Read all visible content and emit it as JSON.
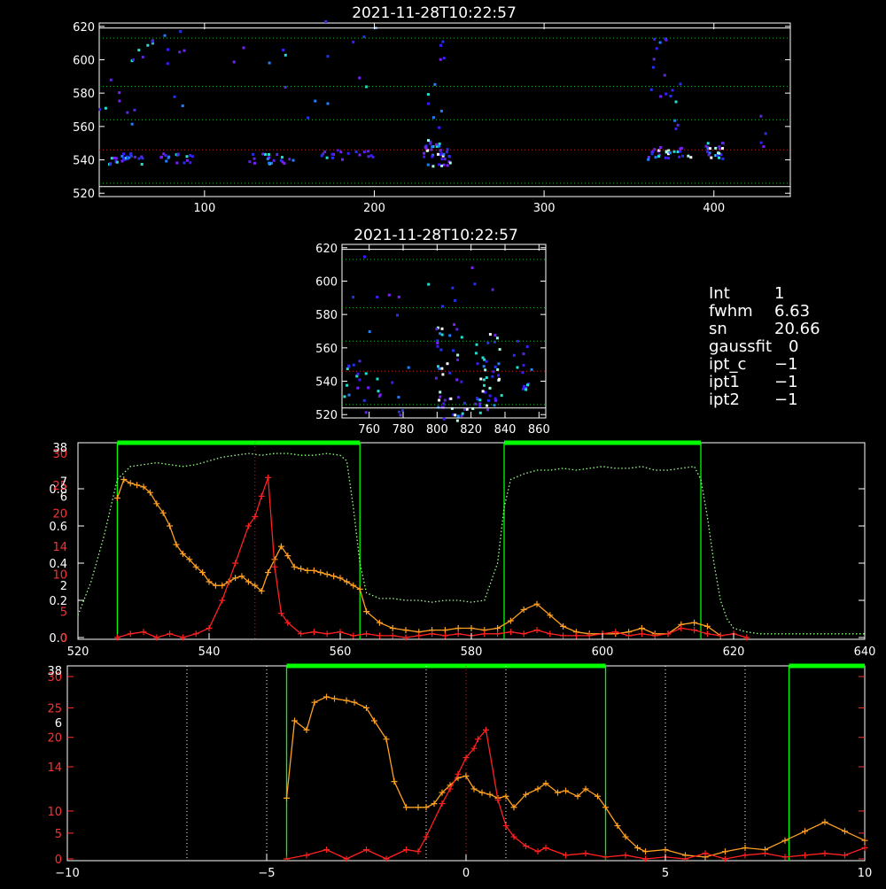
{
  "top_image": {
    "title": "2021-11-28T10:22:57",
    "y_ticks": [
      "520",
      "540",
      "560",
      "580",
      "600",
      "620"
    ],
    "x_ticks": [
      "100",
      "200",
      "300",
      "400"
    ]
  },
  "mid_image": {
    "title": "2021-11-28T10:22:57",
    "y_ticks": [
      "520",
      "540",
      "560",
      "580",
      "600",
      "620"
    ],
    "x_ticks": [
      "760",
      "780",
      "800",
      "820",
      "840",
      "860"
    ]
  },
  "info": {
    "rows": [
      {
        "label": "Int",
        "value": "1"
      },
      {
        "label": "fwhm",
        "value": "6.63"
      },
      {
        "label": "sn",
        "value": "20.66"
      },
      {
        "label": "gaussfit",
        "value": "0"
      },
      {
        "label": "ipt_c",
        "value": "−1"
      },
      {
        "label": "ipt1",
        "value": "−1"
      },
      {
        "label": "ipt2",
        "value": "−1"
      }
    ]
  },
  "colors": {
    "axis": "#ffffff",
    "red_series": "#ff2020",
    "orange_series": "#ffa020",
    "green_window": "#00ff00",
    "dotted_guides": "#ffffff"
  },
  "chart_data": [
    {
      "type": "line",
      "xlim": [
        520,
        640
      ],
      "x_ticks": [
        "520",
        "540",
        "560",
        "580",
        "600",
        "620",
        "640"
      ],
      "ylim_left": [
        0,
        1.0
      ],
      "left_ticks": [
        "0.0",
        "0.2",
        "0.4",
        "0.6",
        "0.8"
      ],
      "left_red_ticks": [
        "0",
        "5",
        "10",
        "14",
        "20",
        "25",
        "30"
      ],
      "left_red_extra_ticks": [
        "2",
        "6",
        "7"
      ],
      "windows": [
        [
          526,
          563
        ],
        [
          585,
          615
        ]
      ],
      "vline": 547,
      "red": {
        "x": [
          526,
          528,
          530,
          532,
          534,
          536,
          538,
          540,
          542,
          544,
          546,
          547,
          548,
          549,
          550,
          551,
          552,
          554,
          556,
          558,
          560,
          562,
          564,
          566,
          568,
          570,
          572,
          574,
          576,
          578,
          580,
          582,
          584,
          586,
          588,
          590,
          592,
          594,
          596,
          598,
          600,
          602,
          604,
          606,
          608,
          610,
          612,
          614,
          616,
          618,
          620,
          622
        ],
        "y": [
          0,
          0.02,
          0.03,
          0,
          0.02,
          0,
          0.02,
          0.05,
          0.2,
          0.4,
          0.6,
          0.65,
          0.76,
          0.86,
          0.38,
          0.13,
          0.08,
          0.02,
          0.03,
          0.02,
          0.03,
          0.01,
          0.02,
          0.01,
          0.01,
          0.0,
          0.01,
          0.02,
          0.01,
          0.02,
          0.01,
          0.02,
          0.02,
          0.03,
          0.02,
          0.04,
          0.02,
          0.01,
          0.01,
          0.01,
          0.02,
          0.03,
          0.01,
          0.02,
          0.01,
          0.02,
          0.05,
          0.04,
          0.02,
          0.01,
          0.02,
          0.0
        ]
      },
      "orange": {
        "x": [
          526,
          527,
          528,
          529,
          530,
          531,
          532,
          533,
          534,
          535,
          536,
          537,
          538,
          539,
          540,
          541,
          542,
          543,
          544,
          545,
          546,
          547,
          548,
          549,
          550,
          551,
          552,
          553,
          554,
          555,
          556,
          557,
          558,
          559,
          560,
          561,
          562,
          563,
          564,
          566,
          568,
          570,
          572,
          574,
          576,
          578,
          580,
          582,
          584,
          586,
          588,
          590,
          592,
          594,
          596,
          598,
          600,
          602,
          604,
          606,
          608,
          610,
          612,
          614,
          616,
          618
        ],
        "y": [
          0.75,
          0.85,
          0.83,
          0.82,
          0.81,
          0.78,
          0.72,
          0.67,
          0.6,
          0.5,
          0.45,
          0.42,
          0.38,
          0.35,
          0.3,
          0.28,
          0.28,
          0.3,
          0.32,
          0.33,
          0.3,
          0.28,
          0.25,
          0.35,
          0.42,
          0.49,
          0.44,
          0.38,
          0.37,
          0.36,
          0.36,
          0.35,
          0.34,
          0.33,
          0.32,
          0.3,
          0.28,
          0.26,
          0.14,
          0.08,
          0.05,
          0.04,
          0.03,
          0.04,
          0.04,
          0.05,
          0.05,
          0.04,
          0.05,
          0.09,
          0.15,
          0.18,
          0.12,
          0.06,
          0.03,
          0.02,
          0.02,
          0.02,
          0.03,
          0.05,
          0.02,
          0.02,
          0.07,
          0.08,
          0.06,
          0.01
        ]
      },
      "green_dotted": {
        "x": [
          520,
          522,
          524,
          526,
          528,
          530,
          532,
          534,
          536,
          538,
          540,
          542,
          544,
          546,
          548,
          550,
          552,
          554,
          556,
          558,
          560,
          561,
          562,
          563,
          564,
          566,
          568,
          570,
          572,
          574,
          576,
          578,
          580,
          582,
          584,
          585,
          586,
          588,
          590,
          592,
          594,
          596,
          598,
          600,
          602,
          604,
          606,
          608,
          610,
          612,
          614,
          615,
          616,
          617,
          618,
          619,
          620,
          622,
          624,
          626,
          628,
          630,
          632,
          634,
          636,
          638,
          640
        ],
        "y": [
          0.12,
          0.3,
          0.55,
          0.85,
          0.92,
          0.93,
          0.94,
          0.93,
          0.92,
          0.93,
          0.95,
          0.97,
          0.98,
          0.99,
          0.98,
          0.99,
          0.99,
          0.98,
          0.98,
          0.99,
          0.98,
          0.95,
          0.7,
          0.4,
          0.24,
          0.21,
          0.21,
          0.2,
          0.2,
          0.19,
          0.2,
          0.2,
          0.19,
          0.2,
          0.4,
          0.7,
          0.85,
          0.88,
          0.9,
          0.9,
          0.91,
          0.9,
          0.91,
          0.92,
          0.91,
          0.91,
          0.92,
          0.9,
          0.9,
          0.91,
          0.92,
          0.85,
          0.65,
          0.4,
          0.2,
          0.1,
          0.05,
          0.03,
          0.02,
          0.02,
          0.02,
          0.02,
          0.02,
          0.02,
          0.02,
          0.02,
          0.02
        ]
      }
    },
    {
      "type": "line",
      "xlim": [
        -10,
        10
      ],
      "x_ticks": [
        "−10",
        "−5",
        "0",
        "5",
        "10"
      ],
      "left_red_ticks": [
        "0",
        "5",
        "10",
        "14",
        "20",
        "25",
        "30"
      ],
      "left_red_extra_ticks": [
        "6"
      ],
      "windows": [
        [
          -4.5,
          3.5
        ],
        [
          8.1,
          10
        ]
      ],
      "dotted_vlines": [
        -7,
        -5,
        -1,
        1,
        5,
        7
      ],
      "red_dotted_vline": 0,
      "red": {
        "x": [
          -4.5,
          -4,
          -3.5,
          -3,
          -2.5,
          -2,
          -1.5,
          -1.2,
          -1,
          -0.6,
          -0.4,
          -0.2,
          0,
          0.2,
          0.3,
          0.5,
          0.8,
          1,
          1.2,
          1.5,
          1.8,
          2,
          2.5,
          3,
          3.5,
          4,
          4.5,
          5,
          5.5,
          6,
          6.5,
          7,
          7.5,
          8,
          8.5,
          9,
          9.5,
          10
        ],
        "y": [
          0.0,
          0.02,
          0.05,
          0.0,
          0.05,
          0.0,
          0.05,
          0.04,
          0.12,
          0.3,
          0.38,
          0.46,
          0.55,
          0.6,
          0.65,
          0.7,
          0.32,
          0.18,
          0.12,
          0.07,
          0.04,
          0.06,
          0.02,
          0.03,
          0.01,
          0.02,
          0.0,
          0.01,
          0.0,
          0.03,
          0.0,
          0.02,
          0.03,
          0.01,
          0.02,
          0.03,
          0.02,
          0.06
        ]
      },
      "orange": {
        "x": [
          -4.5,
          -4.3,
          -4,
          -3.8,
          -3.5,
          -3.3,
          -3,
          -2.8,
          -2.5,
          -2.3,
          -2,
          -1.8,
          -1.5,
          -1.2,
          -1,
          -0.8,
          -0.6,
          -0.4,
          -0.2,
          0,
          0.2,
          0.4,
          0.6,
          0.8,
          1,
          1.2,
          1.5,
          1.8,
          2,
          2.3,
          2.5,
          2.8,
          3,
          3.3,
          3.5,
          3.8,
          4,
          4.3,
          4.5,
          5,
          5.5,
          6,
          6.5,
          7,
          7.5,
          8,
          8.5,
          9,
          9.5,
          10
        ],
        "y": [
          0.33,
          0.75,
          0.7,
          0.85,
          0.88,
          0.87,
          0.86,
          0.85,
          0.82,
          0.75,
          0.65,
          0.42,
          0.28,
          0.28,
          0.28,
          0.3,
          0.36,
          0.4,
          0.44,
          0.45,
          0.38,
          0.36,
          0.35,
          0.33,
          0.34,
          0.28,
          0.35,
          0.38,
          0.41,
          0.36,
          0.37,
          0.34,
          0.38,
          0.34,
          0.28,
          0.18,
          0.12,
          0.06,
          0.04,
          0.05,
          0.02,
          0.01,
          0.04,
          0.06,
          0.05,
          0.1,
          0.15,
          0.2,
          0.15,
          0.1
        ]
      }
    }
  ]
}
